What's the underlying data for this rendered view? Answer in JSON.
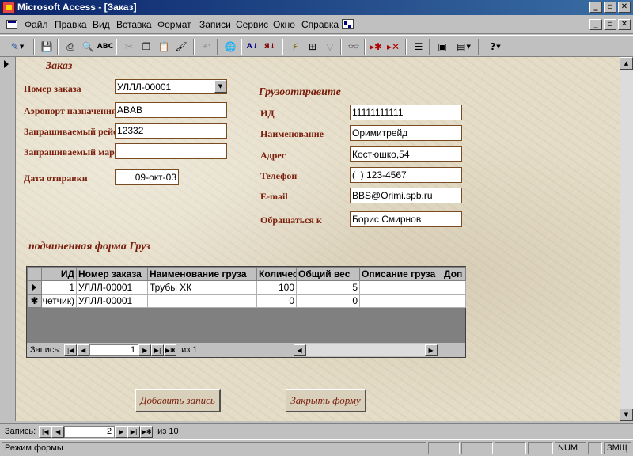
{
  "window": {
    "title": "Microsoft Access - [Заказ]"
  },
  "menu": [
    {
      "label": "Файл"
    },
    {
      "label": "Правка"
    },
    {
      "label": "Вид"
    },
    {
      "label": "Вставка"
    },
    {
      "label": "Формат"
    },
    {
      "label": "Записи"
    },
    {
      "label": "Сервис"
    },
    {
      "label": "Окно"
    },
    {
      "label": "Справка"
    }
  ],
  "toolbar_icons": [
    "view-icon",
    "save-icon",
    "print-icon",
    "print-preview-icon",
    "spelling-icon",
    "cut-icon",
    "copy-icon",
    "paste-icon",
    "format-painter-icon",
    "undo-icon",
    "insert-hyperlink-icon",
    "sort-ascending-icon",
    "sort-descending-icon",
    "filter-by-selection-icon",
    "filter-by-form-icon",
    "apply-filter-icon",
    "find-icon",
    "new-record-icon",
    "delete-record-icon",
    "properties-icon",
    "database-window-icon",
    "new-object-icon",
    "help-icon"
  ],
  "form": {
    "section_title": "Заказ",
    "order_number": {
      "label": "Номер заказа",
      "value": "УЛЛЛ-00001"
    },
    "destination_airport": {
      "label": "Аэропорт назначения",
      "value": "ABAB"
    },
    "requested_flight": {
      "label": "Запрашиваемый рейс",
      "value": "12332"
    },
    "requested_route": {
      "label": "Запрашиваемый маршрут",
      "value": ""
    },
    "ship_date": {
      "label": "Дата отправки",
      "value": "09-окт-03"
    }
  },
  "shipper": {
    "section_title": "Грузоотправите",
    "id": {
      "label": "ИД",
      "value": "11111111111"
    },
    "name": {
      "label": "Наименование",
      "value": "Оримитрейд"
    },
    "address": {
      "label": "Адрес",
      "value": "Костюшко,54"
    },
    "phone": {
      "label": "Телефон",
      "value": "(  ) 123-4567"
    },
    "email": {
      "label": "E-mail",
      "value": "BBS@Orimi.spb.ru"
    },
    "contact": {
      "label": "Обращаться к",
      "value": "Борис Смирнов"
    }
  },
  "subform": {
    "title": "подчиненная форма Груз",
    "columns": [
      "ИД",
      "Номер заказа",
      "Наименование груза",
      "Количество",
      "Общий вес",
      "Описание груза",
      "Доп"
    ],
    "rows": [
      [
        "1",
        "УЛЛЛ-00001",
        "Трубы ХК",
        "100",
        "5",
        "",
        ""
      ],
      [
        "(Счетчик)",
        "УЛЛЛ-00001",
        "",
        "0",
        "0",
        "",
        ""
      ]
    ],
    "nav": {
      "label": "Запись:",
      "current": "1",
      "of": "из  1"
    }
  },
  "buttons": {
    "add_record": "Добавить запись",
    "close_form": "Закрыть форму"
  },
  "main_nav": {
    "label": "Запись:",
    "current": "2",
    "of": "из  10"
  },
  "status": {
    "mode": "Режим формы",
    "num": "NUM",
    "extra": "ЗМЩ"
  }
}
